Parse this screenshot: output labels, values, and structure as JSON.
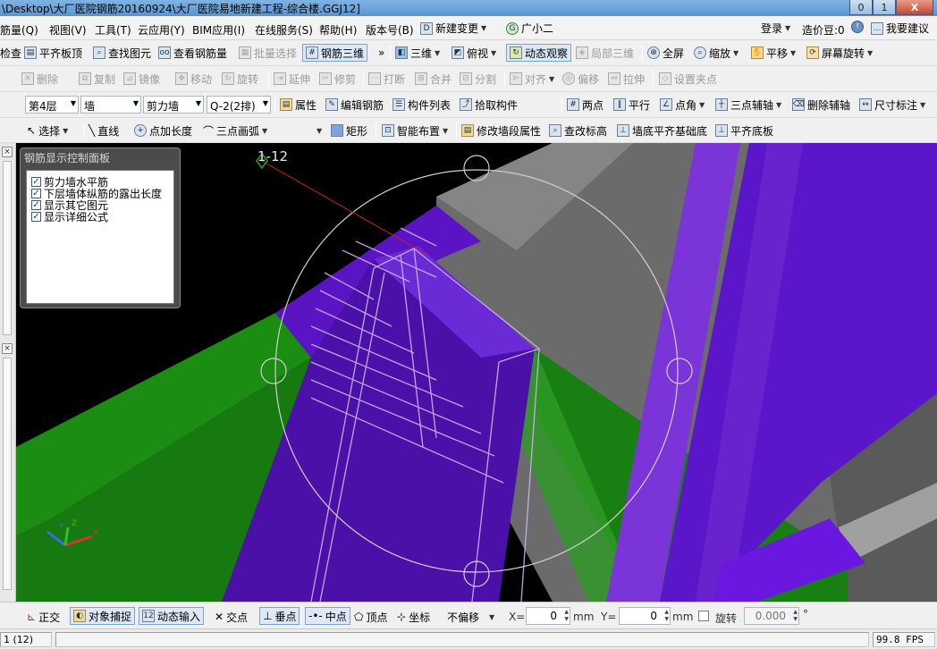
{
  "window": {
    "title": "\\Desktop\\大厂医院钢筋20160924\\大厂医院易地新建工程-综合楼.GGJ12]",
    "min_label": "0",
    "max_label": "1",
    "close_label": "X"
  },
  "menu": {
    "items": [
      "筋量(Q)",
      "视图(V)",
      "工具(T)",
      "云应用(Y)",
      "BIM应用(I)",
      "在线服务(S)",
      "帮助(H)",
      "版本号(B)",
      "新建变更",
      "广小二"
    ],
    "login": "登录",
    "price": "造价豆:0",
    "suggest": "我要建议"
  },
  "toolbar1": {
    "items": [
      "检查",
      "平齐板顶",
      "查找图元",
      "查看钢筋量",
      "批量选择",
      "钢筋三维",
      "三维",
      "俯视",
      "动态观察",
      "局部三维",
      "全屏",
      "缩放",
      "平移",
      "屏幕旋转"
    ]
  },
  "toolbar2": {
    "items": [
      "删除",
      "复制",
      "镜像",
      "移动",
      "旋转",
      "延伸",
      "修剪",
      "打断",
      "合并",
      "分割",
      "对齐",
      "偏移",
      "拉伸",
      "设置夹点"
    ]
  },
  "toolbar3": {
    "floor": "第4层",
    "type": "墙",
    "subtype": "剪力墙",
    "component": "Q-2(2排)",
    "items": [
      "属性",
      "编辑钢筋",
      "构件列表",
      "拾取构件",
      "两点",
      "平行",
      "点角",
      "三点辅轴",
      "删除辅轴",
      "尺寸标注"
    ]
  },
  "toolbar4": {
    "items": [
      "选择",
      "直线",
      "点加长度",
      "三点画弧",
      "矩形",
      "智能布置",
      "修改墙段属性",
      "查改标高",
      "墙底平齐基础底",
      "平齐底板"
    ]
  },
  "viewport": {
    "axis_label": "1-12"
  },
  "panel": {
    "title": "钢筋显示控制面板",
    "options": [
      {
        "label": "剪力墙水平筋",
        "checked": true
      },
      {
        "label": "下层墙体纵筋的露出长度",
        "checked": true
      },
      {
        "label": "显示其它图元",
        "checked": true
      },
      {
        "label": "显示详细公式",
        "checked": true
      }
    ]
  },
  "snapbar": {
    "items": [
      "正交",
      "对象捕捉",
      "动态输入",
      "交点",
      "垂点",
      "中点",
      "顶点",
      "坐标"
    ],
    "offset_mode": "不偏移",
    "x_label": "X=",
    "x_value": "0",
    "y_label": "Y=",
    "y_value": "0",
    "unit": "mm",
    "rotate_label": "旋转",
    "rotate_value": "0.000",
    "degree": "°"
  },
  "statusbar": {
    "cell1": "1 (12)",
    "fps": "99.8 FPS"
  },
  "colors": {
    "purple": "#5b16c9",
    "green": "#1a8a12",
    "gray": "#686868",
    "black": "#000000"
  }
}
